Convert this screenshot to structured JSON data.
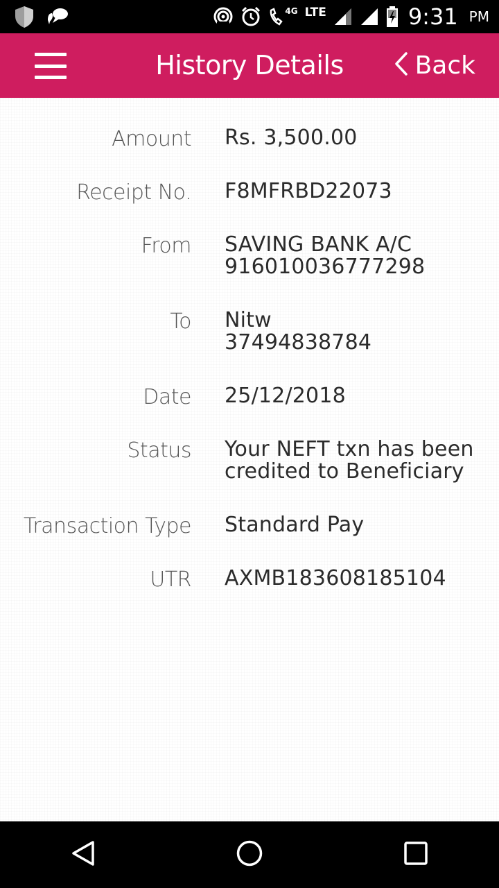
{
  "status_bar": {
    "network_small": "4G",
    "network_type": "LTE",
    "time": "9:31",
    "ampm": "PM"
  },
  "header": {
    "title": "History Details",
    "back_label": "Back"
  },
  "details": [
    {
      "label": "Amount",
      "lines": [
        "Rs. 3,500.00"
      ]
    },
    {
      "label": "Receipt No.",
      "lines": [
        "F8MFRBD22073"
      ]
    },
    {
      "label": "From",
      "lines": [
        "SAVING BANK A/C",
        "916010036777298"
      ]
    },
    {
      "label": "To",
      "lines": [
        "Nitw",
        "37494838784"
      ]
    },
    {
      "label": "Date",
      "lines": [
        "25/12/2018"
      ]
    },
    {
      "label": "Status",
      "lines": [
        "Your NEFT txn has been",
        "credited to Beneficiary"
      ]
    },
    {
      "label": "Transaction Type",
      "lines": [
        "Standard Pay"
      ]
    },
    {
      "label": "UTR",
      "lines": [
        "AXMB183608185104"
      ]
    }
  ],
  "colors": {
    "header_bg": "#cf1d5f",
    "status_bg": "#000000",
    "nav_bg": "#000000"
  },
  "icons": {
    "status_left": [
      "shield-icon",
      "chat-bubble-icon"
    ],
    "status_right": [
      "hotspot-icon",
      "alarm-icon",
      "wifi-call-icon",
      "signal-icon",
      "signal-icon",
      "battery-charging-icon"
    ],
    "nav": [
      "back-triangle-icon",
      "home-circle-icon",
      "recents-square-icon"
    ]
  }
}
